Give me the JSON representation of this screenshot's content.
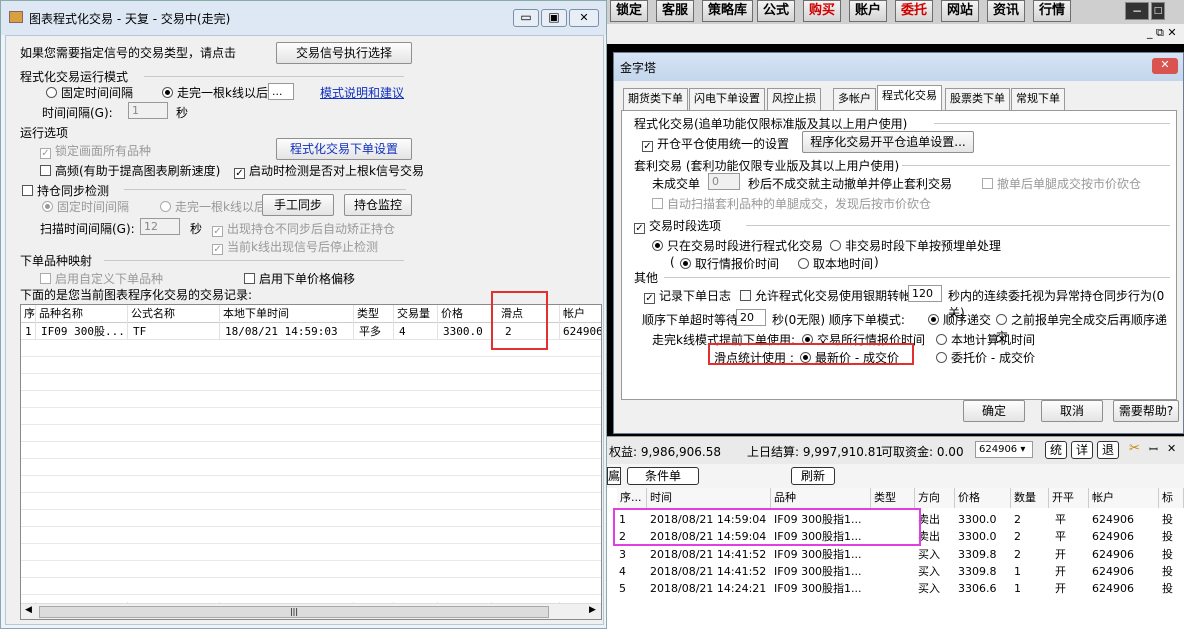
{
  "left": {
    "title": "图表程式化交易 - 天复 - 交易中(走完)",
    "signal_prompt": "如果您需要指定信号的交易类型，请点击",
    "signal_button": "交易信号执行选择",
    "run_mode_label": "程式化交易运行模式",
    "opt_fixed_interval": "固定时间间隔",
    "opt_after_bar": "走完一根k线以后",
    "after_bar_value": "...",
    "mode_link": "模式说明和建议",
    "time_interval_label": "时间间隔(G):",
    "time_interval_value": "1",
    "sec": "秒",
    "run_options_label": "运行选项",
    "lock_variety": "锁定画面所有品种",
    "order_settings_button": "程式化交易下单设置",
    "high_freq": "高频(有助于提高图表刷新速度)",
    "auto_check": "启动时检测是否对上根k信号交易",
    "sync_check_label": "持仓同步检测",
    "sync_fixed": "固定时间间隔",
    "sync_after_bar": "走完一根k线以后",
    "manual_sync_button": "手工同步",
    "monitor_button": "持仓监控",
    "scan_interval_label": "扫描时间间隔(G):",
    "scan_interval_value": "12",
    "auto_correct": "出现持仓不同步后自动矫正持仓",
    "stop_check": "当前k线出现信号后停止检测",
    "mapping_label": "下单品种映射",
    "custom_variety": "启用自定义下单品种",
    "price_offset": "启用下单价格偏移",
    "records_label": "下面的是您当前图表程序化交易的交易记录:",
    "columns": [
      "序",
      "品种名称",
      "公式名称",
      "本地下单时间",
      "类型",
      "交易量",
      "价格",
      "滑点",
      "帐户"
    ],
    "rows": [
      [
        "1",
        "IF09 300股...",
        "TF",
        "18/08/21 14:59:03",
        "平多",
        "4",
        "3300.0",
        "2",
        "624906"
      ]
    ],
    "highlight_color": "#e03030"
  },
  "topbar": {
    "buttons": [
      "锁定",
      "客服",
      "策略库",
      "公式",
      "购买",
      "账户",
      "委托",
      "网站",
      "资讯",
      "行情"
    ]
  },
  "dialog": {
    "title": "金字塔",
    "tabs": [
      "期货类下单",
      "闪电下单设置",
      "风控止损",
      "多帐户",
      "程式化交易",
      "股票类下单",
      "常规下单"
    ],
    "active_tab": "程式化交易",
    "sec_prog": "程式化交易(追单功能仅限标准版及其以上用户使用)",
    "unify_open_close": "开仓平仓使用统一的设置",
    "chase_button": "程序化交易开平仓追单设置...",
    "sec_arb": "套利交易 (套利功能仅限专业版及其以上用户使用)",
    "unfilled_prefix": "未成交单",
    "unfilled_value": "0",
    "unfilled_suffix": "秒后不成交就主动撤单并停止套利交易",
    "cancel_after": "撤单后单腿成交按市价砍仓",
    "auto_scan": "自动扫描套利品种的单腿成交，发现后按市价砍仓",
    "trade_period": "交易时段选项",
    "only_in_period": "只在交易时段进行程式化交易",
    "off_period": "非交易时段下单按预埋单处理",
    "take_quote_time": "取行情报价时间",
    "take_local_time": "取本地时间",
    "other_label": "其他",
    "record_log": "记录下单日志",
    "allow_prefix": "允许程式化交易使用银期转帐",
    "allow_value": "120",
    "allow_suffix": "秒内的连续委托视为异常持仓同步行为(0关)",
    "seq_timeout_prefix": "顺序下单超时等待",
    "seq_timeout_value": "20",
    "seq_timeout_suffix": "秒(0无限) 顺序下单模式:",
    "seq_mode_1": "顺序递交",
    "seq_mode_2": "之前报单完全成交后再顺序递交",
    "early_order_label": "走完k线模式提前下单使用:",
    "early_quote_time": "交易所行情报价时间",
    "early_local_time": "本地计算机时间",
    "slip_label": "滑点统计使用 :",
    "slip_latest": "最新价 - 成交价",
    "slip_order": "委托价 - 成交价",
    "ok": "确定",
    "cancel": "取消",
    "help": "需要帮助?"
  },
  "bottom": {
    "equity": "权益: 9,986,906.58",
    "last_settle": "上日结算: 9,997,910.81",
    "available": "可取资金: 0.00",
    "account": "624906",
    "btn_stat": "统",
    "btn_detail": "详",
    "btn_exit": "退",
    "tab_left": "鳸",
    "cond_order": "条件单",
    "refresh": "刷新",
    "columns": [
      "序...",
      "时间",
      "品种",
      "类型",
      "方向",
      "价格",
      "数量",
      "开平",
      "帐户",
      "标"
    ],
    "rows": [
      [
        "1",
        "2018/08/21 14:59:04",
        "IF09 300股指1...",
        "",
        "卖出",
        "3300.0",
        "2",
        "平",
        "624906",
        "投"
      ],
      [
        "2",
        "2018/08/21 14:59:04",
        "IF09 300股指1...",
        "",
        "卖出",
        "3300.0",
        "2",
        "平",
        "624906",
        "投"
      ],
      [
        "3",
        "2018/08/21 14:41:52",
        "IF09 300股指1...",
        "",
        "买入",
        "3309.8",
        "2",
        "开",
        "624906",
        "投"
      ],
      [
        "4",
        "2018/08/21 14:41:52",
        "IF09 300股指1...",
        "",
        "买入",
        "3309.8",
        "1",
        "开",
        "624906",
        "投"
      ],
      [
        "5",
        "2018/08/21 14:24:21",
        "IF09 300股指1...",
        "",
        "买入",
        "3306.6",
        "1",
        "开",
        "624906",
        "投"
      ]
    ],
    "highlight_color": "#e040e0"
  }
}
